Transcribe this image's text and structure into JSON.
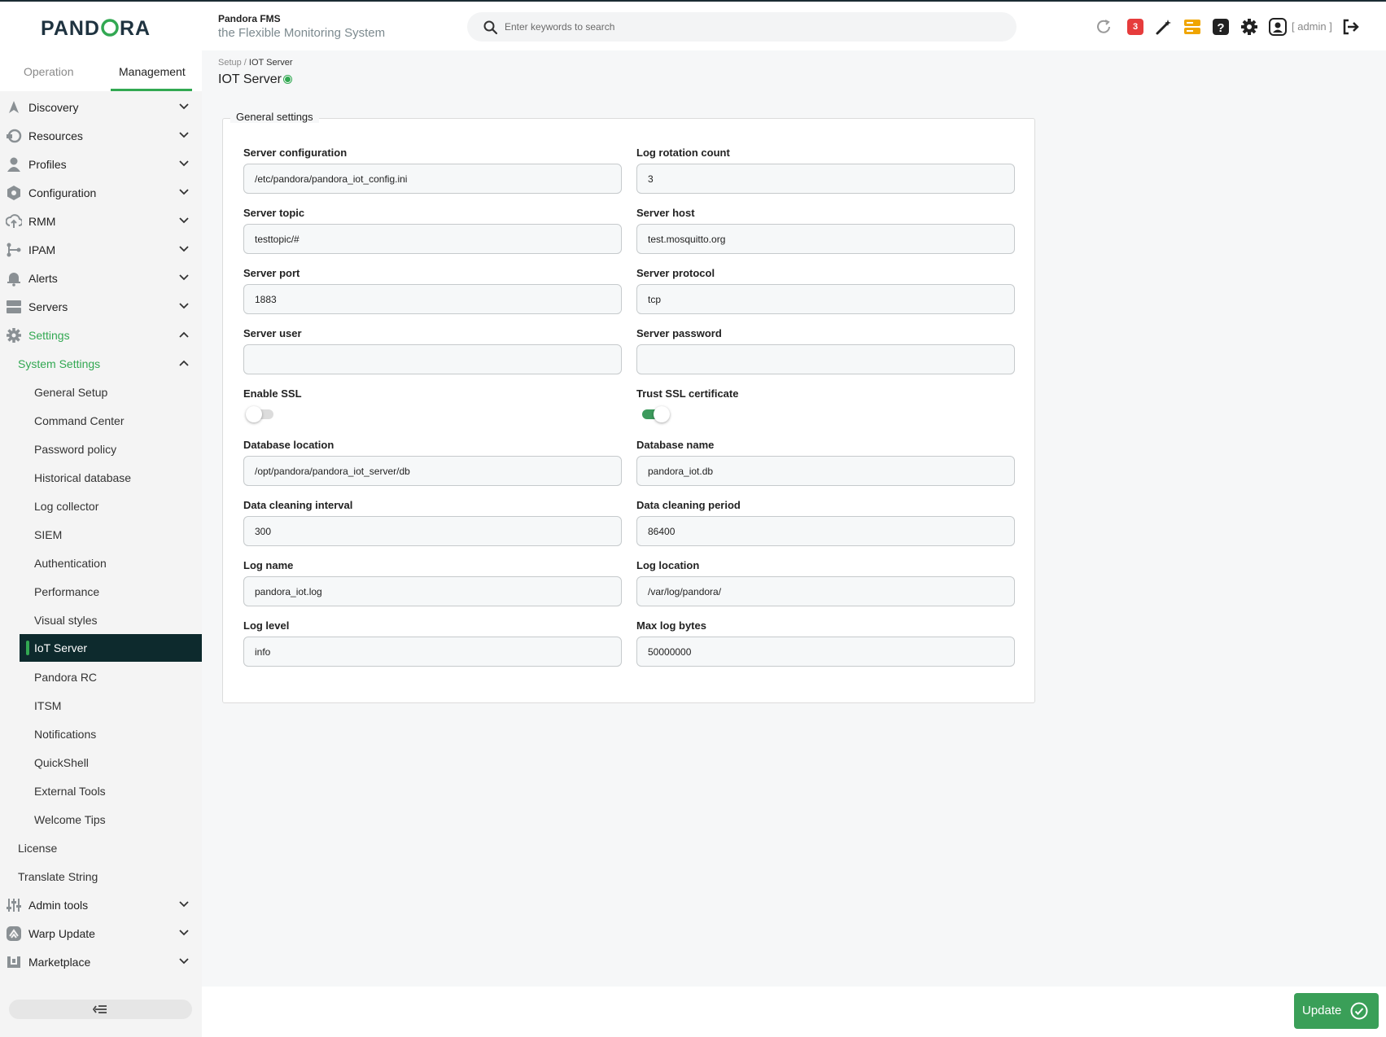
{
  "header": {
    "logo_text": "PANDORA",
    "brand_title": "Pandora FMS",
    "brand_subtitle": "the Flexible Monitoring System",
    "search_placeholder": "Enter keywords to search",
    "notification_count": "3",
    "user_label": "[ admin ]",
    "icons": [
      "refresh-icon",
      "notification-badge",
      "wand-icon",
      "server-status-icon",
      "help-icon",
      "gear-icon",
      "user-icon",
      "logout-icon"
    ]
  },
  "tabs": {
    "operation": "Operation",
    "management": "Management"
  },
  "sidebar": {
    "items": [
      {
        "label": "Discovery",
        "icon": "rocket-icon"
      },
      {
        "label": "Resources",
        "icon": "resources-icon"
      },
      {
        "label": "Profiles",
        "icon": "user-icon"
      },
      {
        "label": "Configuration",
        "icon": "configuration-icon"
      },
      {
        "label": "RMM",
        "icon": "rmm-icon"
      },
      {
        "label": "IPAM",
        "icon": "ipam-icon"
      },
      {
        "label": "Alerts",
        "icon": "bell-icon"
      },
      {
        "label": "Servers",
        "icon": "servers-icon"
      },
      {
        "label": "Settings",
        "icon": "gear-icon"
      }
    ],
    "system_settings": "System Settings",
    "system_subitems": [
      "General Setup",
      "Command Center",
      "Password policy",
      "Historical database",
      "Log collector",
      "SIEM",
      "Authentication",
      "Performance",
      "Visual styles",
      "IoT Server",
      "Pandora RC",
      "ITSM",
      "Notifications",
      "QuickShell",
      "External Tools",
      "Welcome Tips"
    ],
    "license": "License",
    "translate_string": "Translate String",
    "bottom_items": [
      {
        "label": "Admin tools",
        "icon": "sliders-icon"
      },
      {
        "label": "Warp Update",
        "icon": "warp-icon"
      },
      {
        "label": "Marketplace",
        "icon": "marketplace-icon"
      }
    ],
    "accent_color": "#32a852",
    "active_bg": "#0d2a2d"
  },
  "breadcrumb": {
    "parent": "Setup /",
    "current": "IOT Server"
  },
  "page_title": "IOT Server",
  "form": {
    "legend": "General settings",
    "fields": {
      "server_configuration": {
        "label": "Server configuration",
        "value": "/etc/pandora/pandora_iot_config.ini"
      },
      "log_rotation_count": {
        "label": "Log rotation count",
        "value": "3"
      },
      "server_topic": {
        "label": "Server topic",
        "value": "testtopic/#"
      },
      "server_host": {
        "label": "Server host",
        "value": "test.mosquitto.org"
      },
      "server_port": {
        "label": "Server port",
        "value": "1883"
      },
      "server_protocol": {
        "label": "Server protocol",
        "value": "tcp"
      },
      "server_user": {
        "label": "Server user",
        "value": ""
      },
      "server_password": {
        "label": "Server password",
        "value": ""
      },
      "database_location": {
        "label": "Database location",
        "value": "/opt/pandora/pandora_iot_server/db"
      },
      "database_name": {
        "label": "Database name",
        "value": "pandora_iot.db"
      },
      "data_cleaning_interval": {
        "label": "Data cleaning interval",
        "value": "300"
      },
      "data_cleaning_period": {
        "label": "Data cleaning period",
        "value": "86400"
      },
      "log_name": {
        "label": "Log name",
        "value": "pandora_iot.log"
      },
      "log_location": {
        "label": "Log location",
        "value": "/var/log/pandora/"
      },
      "log_level": {
        "label": "Log level",
        "value": "info"
      },
      "max_log_bytes": {
        "label": "Max log bytes",
        "value": "50000000"
      }
    },
    "toggles": {
      "enable_ssl": {
        "label": "Enable SSL",
        "on": false
      },
      "trust_ssl": {
        "label": "Trust SSL certificate",
        "on": true
      }
    }
  },
  "footer": {
    "update_label": "Update",
    "button_color": "#3a9f58"
  }
}
